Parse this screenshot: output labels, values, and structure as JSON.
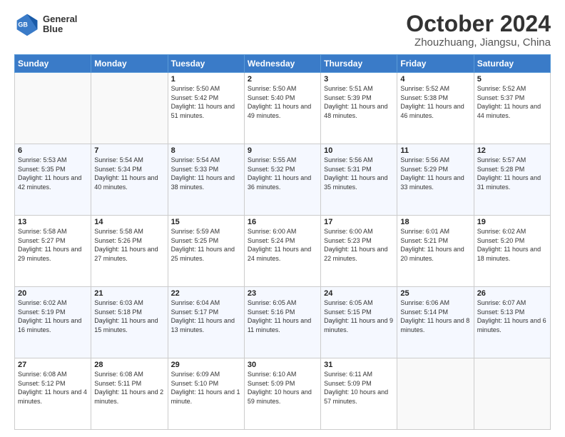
{
  "header": {
    "logo_line1": "General",
    "logo_line2": "Blue",
    "title": "October 2024",
    "subtitle": "Zhouzhuang, Jiangsu, China"
  },
  "weekdays": [
    "Sunday",
    "Monday",
    "Tuesday",
    "Wednesday",
    "Thursday",
    "Friday",
    "Saturday"
  ],
  "weeks": [
    [
      {
        "day": "",
        "info": ""
      },
      {
        "day": "",
        "info": ""
      },
      {
        "day": "1",
        "info": "Sunrise: 5:50 AM\nSunset: 5:42 PM\nDaylight: 11 hours and 51 minutes."
      },
      {
        "day": "2",
        "info": "Sunrise: 5:50 AM\nSunset: 5:40 PM\nDaylight: 11 hours and 49 minutes."
      },
      {
        "day": "3",
        "info": "Sunrise: 5:51 AM\nSunset: 5:39 PM\nDaylight: 11 hours and 48 minutes."
      },
      {
        "day": "4",
        "info": "Sunrise: 5:52 AM\nSunset: 5:38 PM\nDaylight: 11 hours and 46 minutes."
      },
      {
        "day": "5",
        "info": "Sunrise: 5:52 AM\nSunset: 5:37 PM\nDaylight: 11 hours and 44 minutes."
      }
    ],
    [
      {
        "day": "6",
        "info": "Sunrise: 5:53 AM\nSunset: 5:35 PM\nDaylight: 11 hours and 42 minutes."
      },
      {
        "day": "7",
        "info": "Sunrise: 5:54 AM\nSunset: 5:34 PM\nDaylight: 11 hours and 40 minutes."
      },
      {
        "day": "8",
        "info": "Sunrise: 5:54 AM\nSunset: 5:33 PM\nDaylight: 11 hours and 38 minutes."
      },
      {
        "day": "9",
        "info": "Sunrise: 5:55 AM\nSunset: 5:32 PM\nDaylight: 11 hours and 36 minutes."
      },
      {
        "day": "10",
        "info": "Sunrise: 5:56 AM\nSunset: 5:31 PM\nDaylight: 11 hours and 35 minutes."
      },
      {
        "day": "11",
        "info": "Sunrise: 5:56 AM\nSunset: 5:29 PM\nDaylight: 11 hours and 33 minutes."
      },
      {
        "day": "12",
        "info": "Sunrise: 5:57 AM\nSunset: 5:28 PM\nDaylight: 11 hours and 31 minutes."
      }
    ],
    [
      {
        "day": "13",
        "info": "Sunrise: 5:58 AM\nSunset: 5:27 PM\nDaylight: 11 hours and 29 minutes."
      },
      {
        "day": "14",
        "info": "Sunrise: 5:58 AM\nSunset: 5:26 PM\nDaylight: 11 hours and 27 minutes."
      },
      {
        "day": "15",
        "info": "Sunrise: 5:59 AM\nSunset: 5:25 PM\nDaylight: 11 hours and 25 minutes."
      },
      {
        "day": "16",
        "info": "Sunrise: 6:00 AM\nSunset: 5:24 PM\nDaylight: 11 hours and 24 minutes."
      },
      {
        "day": "17",
        "info": "Sunrise: 6:00 AM\nSunset: 5:23 PM\nDaylight: 11 hours and 22 minutes."
      },
      {
        "day": "18",
        "info": "Sunrise: 6:01 AM\nSunset: 5:21 PM\nDaylight: 11 hours and 20 minutes."
      },
      {
        "day": "19",
        "info": "Sunrise: 6:02 AM\nSunset: 5:20 PM\nDaylight: 11 hours and 18 minutes."
      }
    ],
    [
      {
        "day": "20",
        "info": "Sunrise: 6:02 AM\nSunset: 5:19 PM\nDaylight: 11 hours and 16 minutes."
      },
      {
        "day": "21",
        "info": "Sunrise: 6:03 AM\nSunset: 5:18 PM\nDaylight: 11 hours and 15 minutes."
      },
      {
        "day": "22",
        "info": "Sunrise: 6:04 AM\nSunset: 5:17 PM\nDaylight: 11 hours and 13 minutes."
      },
      {
        "day": "23",
        "info": "Sunrise: 6:05 AM\nSunset: 5:16 PM\nDaylight: 11 hours and 11 minutes."
      },
      {
        "day": "24",
        "info": "Sunrise: 6:05 AM\nSunset: 5:15 PM\nDaylight: 11 hours and 9 minutes."
      },
      {
        "day": "25",
        "info": "Sunrise: 6:06 AM\nSunset: 5:14 PM\nDaylight: 11 hours and 8 minutes."
      },
      {
        "day": "26",
        "info": "Sunrise: 6:07 AM\nSunset: 5:13 PM\nDaylight: 11 hours and 6 minutes."
      }
    ],
    [
      {
        "day": "27",
        "info": "Sunrise: 6:08 AM\nSunset: 5:12 PM\nDaylight: 11 hours and 4 minutes."
      },
      {
        "day": "28",
        "info": "Sunrise: 6:08 AM\nSunset: 5:11 PM\nDaylight: 11 hours and 2 minutes."
      },
      {
        "day": "29",
        "info": "Sunrise: 6:09 AM\nSunset: 5:10 PM\nDaylight: 11 hours and 1 minute."
      },
      {
        "day": "30",
        "info": "Sunrise: 6:10 AM\nSunset: 5:09 PM\nDaylight: 10 hours and 59 minutes."
      },
      {
        "day": "31",
        "info": "Sunrise: 6:11 AM\nSunset: 5:09 PM\nDaylight: 10 hours and 57 minutes."
      },
      {
        "day": "",
        "info": ""
      },
      {
        "day": "",
        "info": ""
      }
    ]
  ]
}
